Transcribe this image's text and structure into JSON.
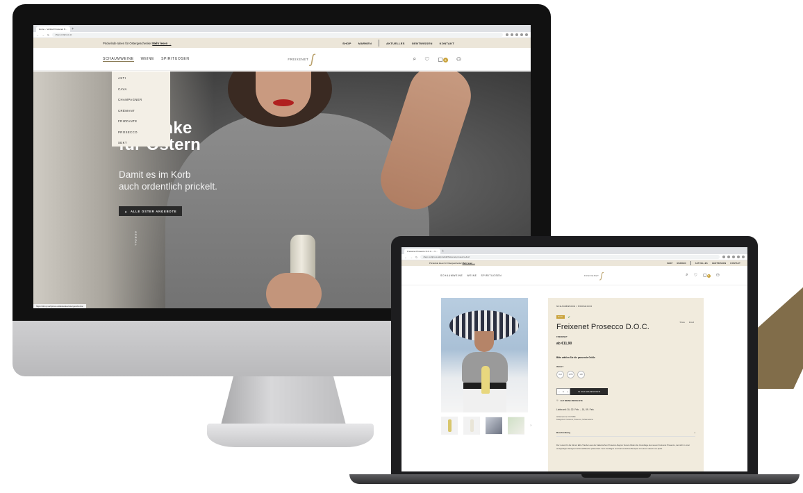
{
  "desktop": {
    "tab_title": "Home – Vertrieb Freixenet Ö…",
    "url": "shop.vertiprous.at",
    "promo": {
      "text": "Prickelnde Ideen für Ostergeschenke!",
      "link": "Mehr lesen →"
    },
    "top_links": [
      "SHOP",
      "MARKEN",
      "AKTUELLES",
      "GENTWISSEN",
      "KONTAKT"
    ],
    "nav": [
      "SCHAUMWEINE",
      "WEINE",
      "SPIRITUOSEN"
    ],
    "logo": "FREIXENET",
    "dropdown": [
      "ASTI",
      "CAVA",
      "CHAMPAGNER",
      "CRÉMANT",
      "FRIZZANTE",
      "PROSECCO",
      "SEKT"
    ],
    "hero": {
      "title_line1": "enke",
      "title_line2": "für Ostern",
      "subtitle_line1": "Damit es im Korb",
      "subtitle_line2": "auch ordentlich prickelt.",
      "button": "ALLE OSTER ANGEBOTE",
      "scroll": "SCROLL"
    },
    "status_url": "https://shop.vertiprous.at/aktuelles/ostergeschenke"
  },
  "laptop": {
    "tab_title": "Freixenet Prosecco D.O.C. – V…",
    "url": "shop.vertiprous.at/produkt/freixenet-prosecco-doc/",
    "promo": {
      "text": "Prickelnde Ideen für Ostergeschenke!",
      "link": "Mehr lesen →"
    },
    "top_links": [
      "SHOP",
      "MARKEN",
      "AKTUELLES",
      "GENTWISSEN",
      "KONTAKT"
    ],
    "nav": [
      "SCHAUMWEINE",
      "WEINE",
      "SPIRITUOSEN"
    ],
    "logo": "FREIXENET",
    "product": {
      "breadcrumb": "SCHAUMWEINE / PROSECCO",
      "badge": "D.O.C.",
      "share": [
        "Share",
        "Email"
      ],
      "title": "Freixenet Prosecco D.O.C.",
      "producer": "FREIXENET",
      "price": "ab €11,90",
      "choose": "Bitte wählen Sie die passende Größe",
      "size_label": "INHALT",
      "sizes": [
        "0,2l",
        "0,75l",
        "1,5l"
      ],
      "qty": "1",
      "add_to_cart": "IN DEN WARENKORB",
      "wishlist": "AUF MEINE MERKLISTE",
      "delivery": "Lieferzeit: Di, 02. Feb. – Di, 09. Feb.",
      "meta_line1": "Artikelnummer: F471950",
      "meta_line2": "Kategorien: Freixenet, Prosecco, Schaumweine",
      "desc_head": "Beschreibung",
      "desc": "Der Luxus für die Sinne! Edle Trauben aus der italienischen Prosecco-Region Veneto bilden die Grundlage des neuen Freixenet Prosecco, der sich in einer einzigartigen Designer-Schmuckflasche präsentiert. Sein fruchtiges und harmonisches Bouquet mit einem Hauch von Apfel."
    }
  },
  "colors": {
    "gold": "#c9a23a",
    "cream": "#ece6d9",
    "panel": "#f1ebdd",
    "stripe": "#7a6540"
  }
}
